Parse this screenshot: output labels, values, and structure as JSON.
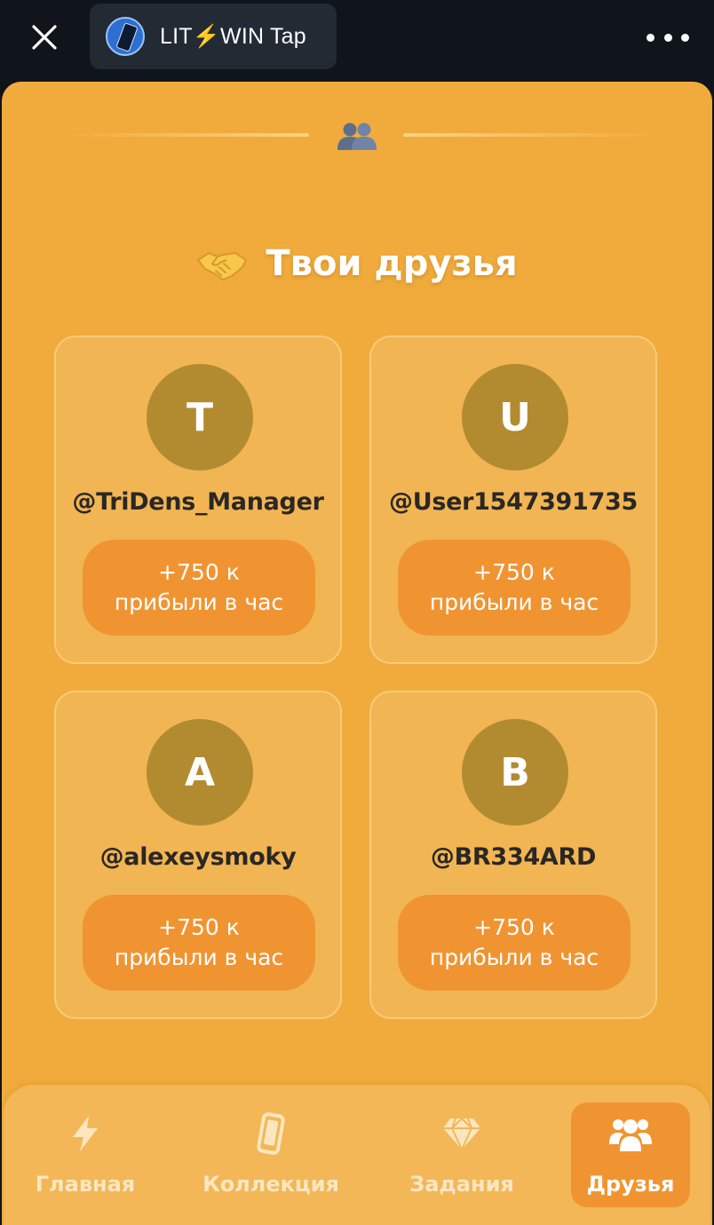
{
  "topbar": {
    "app_title": "LIT⚡WIN Tap"
  },
  "section": {
    "title": "Твои друзья"
  },
  "friends": [
    {
      "initial": "T",
      "username": "@TriDens_Manager",
      "profit_line1": "+750 к",
      "profit_line2": "прибыли в час"
    },
    {
      "initial": "U",
      "username": "@User1547391735",
      "profit_line1": "+750 к",
      "profit_line2": "прибыли в час"
    },
    {
      "initial": "A",
      "username": "@alexeysmoky",
      "profit_line1": "+750 к",
      "profit_line2": "прибыли в час"
    },
    {
      "initial": "B",
      "username": "@BR334ARD",
      "profit_line1": "+750 к",
      "profit_line2": "прибыли в час"
    }
  ],
  "nav": {
    "items": [
      {
        "label": "Главная",
        "icon": "lightning-icon",
        "active": false
      },
      {
        "label": "Коллекция",
        "icon": "phone-icon",
        "active": false
      },
      {
        "label": "Задания",
        "icon": "diamond-icon",
        "active": false
      },
      {
        "label": "Друзья",
        "icon": "friends-icon",
        "active": true
      }
    ]
  },
  "colors": {
    "panel_bg": "#f0ab3c",
    "accent_orange": "#f09432",
    "avatar_bg": "#b28b31",
    "topbar_bg": "#10151c"
  }
}
